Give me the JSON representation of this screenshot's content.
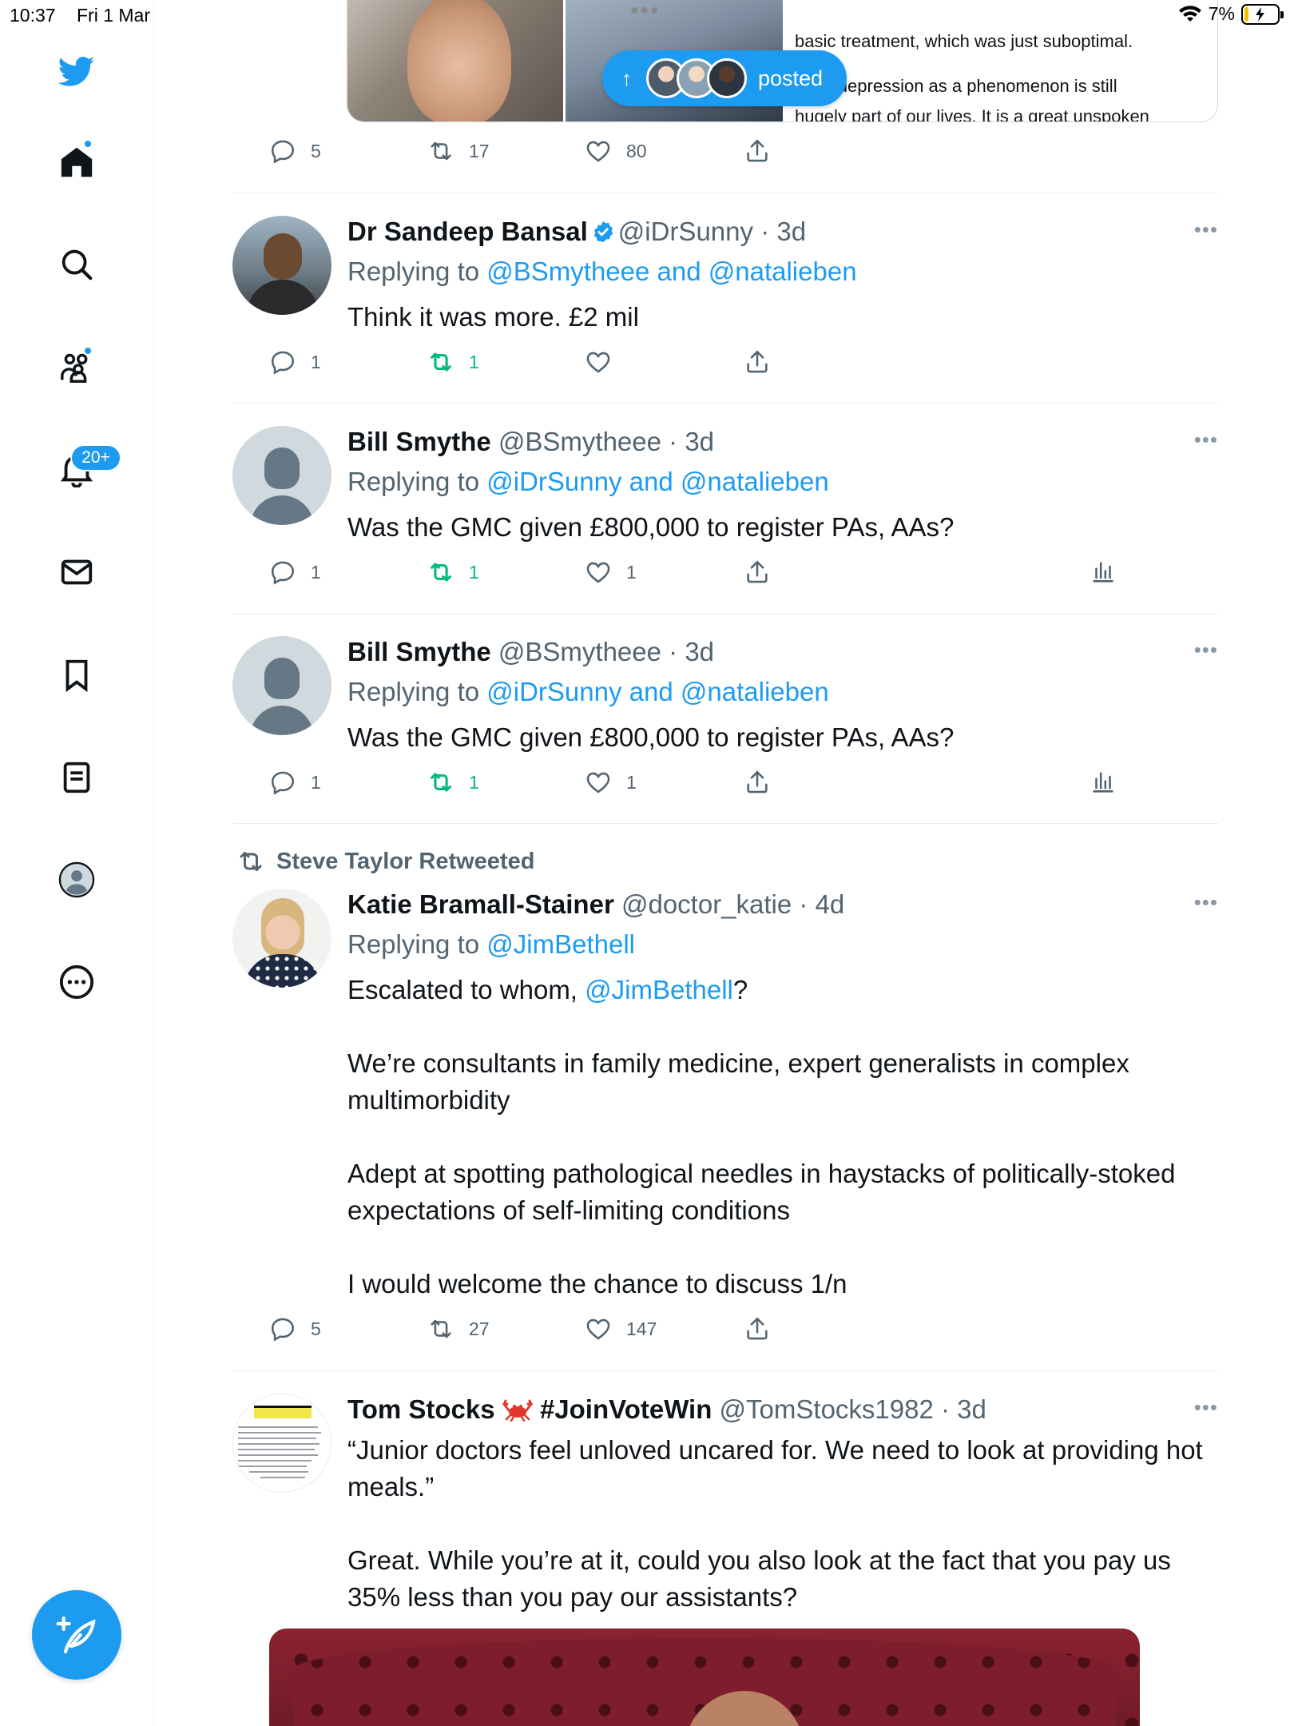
{
  "status_bar": {
    "time": "10:37",
    "date": "Fri 1 Mar",
    "battery": "7%"
  },
  "sidebar": {
    "notifications_badge": "20+",
    "items": [
      "home",
      "explore",
      "communities",
      "notifications",
      "messages",
      "bookmarks",
      "lists",
      "profile",
      "more"
    ]
  },
  "quoted_card": {
    "text_lines": [
      "basic treatment, which was just suboptimal.",
      "natal depression as a phenomenon is still",
      "hugely part of our lives. It is a great unspoken"
    ]
  },
  "posted_pill": {
    "label": "posted"
  },
  "top_actions": {
    "replies": "5",
    "retweets": "17",
    "likes": "80"
  },
  "tweets": [
    {
      "name": "Dr Sandeep Bansal",
      "handle": "@iDrSunny",
      "time": "· 3d",
      "replying_prefix": "Replying to ",
      "replying_to": "@BSmytheee and @natalieben",
      "text": "Think it was more. £2 mil",
      "replies": "1",
      "retweets": "1",
      "likes": ""
    },
    {
      "name": "Bill Smythe",
      "handle": "@BSmytheee",
      "time": "· 3d",
      "replying_prefix": "Replying to ",
      "replying_to": "@iDrSunny and @natalieben",
      "text": "Was the GMC given £800,000 to register PAs, AAs?",
      "replies": "1",
      "retweets": "1",
      "likes": "1"
    },
    {
      "name": "Bill Smythe",
      "handle": "@BSmytheee",
      "time": "· 3d",
      "replying_prefix": "Replying to ",
      "replying_to": "@iDrSunny and @natalieben",
      "text": "Was the GMC given £800,000 to register PAs, AAs?",
      "replies": "1",
      "retweets": "1",
      "likes": "1"
    },
    {
      "retweeted_by": "Steve Taylor Retweeted",
      "name": "Katie Bramall-Stainer",
      "handle": "@doctor_katie",
      "time": "· 4d",
      "replying_prefix": "Replying to ",
      "replying_to": "@JimBethell",
      "text_before": "Escalated to whom, ",
      "text_mention": "@JimBethell",
      "text_after": "?\n\nWe’re consultants in family medicine, expert generalists in complex multimorbidity\n\nAdept at spotting pathological needles in haystacks of politically-stoked expectations of self-limiting conditions\n\nI would welcome the chance to discuss 1/n",
      "replies": "5",
      "retweets": "27",
      "likes": "147"
    },
    {
      "name": "Tom Stocks",
      "name_suffix": "#JoinVoteWin",
      "handle": "@TomStocks1982",
      "time": "· 3d",
      "text": "“Junior doctors feel unloved uncared for. We need to look at providing hot meals.”\n\nGreat. While you’re at it, could you also look at the fact that you pay us 35% less than you pay our assistants?"
    }
  ],
  "colors": {
    "accent": "#1d9bf0",
    "retweet_green": "#00ba7c",
    "muted": "#536471"
  }
}
